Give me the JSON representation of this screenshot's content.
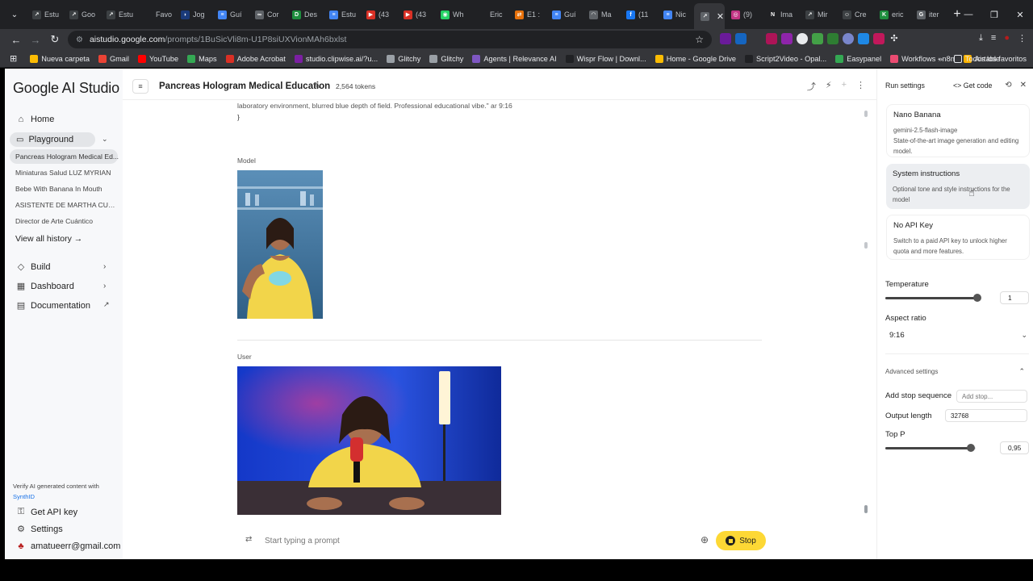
{
  "browser": {
    "tabs": [
      {
        "label": "Estu",
        "color": "#3c4043",
        "glyph": "↗"
      },
      {
        "label": "Goo",
        "color": "#3c4043",
        "glyph": "↗"
      },
      {
        "label": "Estu",
        "color": "#3c4043",
        "glyph": "↗"
      },
      {
        "label": "Favo",
        "color": "#202124",
        "glyph": ""
      },
      {
        "label": "Jog",
        "color": "#1a3a7a",
        "glyph": "◗"
      },
      {
        "label": "Guí",
        "color": "#4285f4",
        "glyph": "≡"
      },
      {
        "label": "Cor",
        "color": "#5f6368",
        "glyph": "∞"
      },
      {
        "label": "Des",
        "color": "#1e8e3e",
        "glyph": "D"
      },
      {
        "label": "Estu",
        "color": "#4285f4",
        "glyph": "≡"
      },
      {
        "label": "(43",
        "color": "#d93025",
        "glyph": "▶"
      },
      {
        "label": "(43",
        "color": "#d93025",
        "glyph": "▶"
      },
      {
        "label": "Wh",
        "color": "#25d366",
        "glyph": "◉"
      },
      {
        "label": "Eric",
        "color": "#202124",
        "glyph": ""
      },
      {
        "label": "E1 :",
        "color": "#e8710a",
        "glyph": "⇄"
      },
      {
        "label": "Guí",
        "color": "#4285f4",
        "glyph": "≡"
      },
      {
        "label": "Ma",
        "color": "#5f6368",
        "glyph": "◠"
      },
      {
        "label": "(11",
        "color": "#1877f2",
        "glyph": "f"
      },
      {
        "label": "Nic",
        "color": "#4285f4",
        "glyph": "≡"
      },
      {
        "label": "",
        "color": "#5f6368",
        "glyph": "↗",
        "active": true
      },
      {
        "label": "(9)",
        "color": "#c13584",
        "glyph": "◎"
      },
      {
        "label": "Ima",
        "color": "#202124",
        "glyph": "N"
      },
      {
        "label": "Mir",
        "color": "#3c4043",
        "glyph": "↗"
      },
      {
        "label": "Cre",
        "color": "#3c4043",
        "glyph": "☺"
      },
      {
        "label": "eric",
        "color": "#1e8e3e",
        "glyph": "K"
      },
      {
        "label": "iter",
        "color": "#5f6368",
        "glyph": "G"
      }
    ],
    "url_host": "aistudio.google.com",
    "url_path": "/prompts/1BuSicVli8m-U1P8siUXVionMAh6bxlst",
    "bookmarks": [
      {
        "label": "Nueva carpeta",
        "color": "#fbbc04"
      },
      {
        "label": "Gmail",
        "color": "#ea4335"
      },
      {
        "label": "YouTube",
        "color": "#ff0000"
      },
      {
        "label": "Maps",
        "color": "#34a853"
      },
      {
        "label": "Adobe Acrobat",
        "color": "#d93025"
      },
      {
        "label": "studio.clipwise.ai/?u...",
        "color": "#7b1fa2"
      },
      {
        "label": "Glitchy",
        "color": "#9aa0a6"
      },
      {
        "label": "Glitchy",
        "color": "#9aa0a6"
      },
      {
        "label": "Agents | Relevance AI",
        "color": "#7e57c2"
      },
      {
        "label": "Wispr Flow | Downl...",
        "color": "#202124"
      },
      {
        "label": "Home - Google Drive",
        "color": "#fbbc04"
      },
      {
        "label": "Script2Video - Opal...",
        "color": "#202124"
      },
      {
        "label": "Easypanel",
        "color": "#34a853"
      },
      {
        "label": "Workflows - n8n",
        "color": "#ea4b71"
      },
      {
        "label": "Airtable",
        "color": "#fcb400"
      }
    ],
    "bookmarks_overflow": "»",
    "all_bookmarks": "Todos los favoritos"
  },
  "sidebar": {
    "logo": "Google AI Studio",
    "home": "Home",
    "playground": "Playground",
    "history": [
      "Pancreas Hologram Medical Ed...",
      "Miniaturas Salud LUZ MYRIAN",
      "Bebe With Banana In Mouth",
      "ASISTENTE DE MARTHA CUAN...",
      "Director de Arte Cuántico"
    ],
    "view_all": "View all history →",
    "build": "Build",
    "dashboard": "Dashboard",
    "documentation": "Documentation",
    "verify_text": "Verify AI generated content with",
    "verify_link": "SynthID",
    "get_api_key": "Get API key",
    "settings": "Settings",
    "account": "amatueerr@gmail.com"
  },
  "header": {
    "title": "Pancreas Hologram Medical Education",
    "tokens": "2,564 tokens"
  },
  "chat": {
    "code_line_1": "laboratory environment, blurred blue depth of field. Professional educational vibe.\"   ar 9:16",
    "code_line_2": "}",
    "model_label": "Model",
    "user_label": "User",
    "prompt_placeholder": "Start typing a prompt",
    "stop_label": "Stop"
  },
  "run_settings": {
    "title": "Run settings",
    "get_code": "Get code",
    "model_name": "Nano Banana",
    "model_id": "gemini-2.5-flash-image",
    "model_desc": "State-of-the-art image generation and editing model.",
    "sys_title": "System instructions",
    "sys_desc": "Optional tone and style instructions for the model",
    "api_title": "No API Key",
    "api_desc": "Switch to a paid API key to unlock higher quota and more features.",
    "temperature_label": "Temperature",
    "temperature_value": "1",
    "temperature_fraction": 0.5,
    "aspect_label": "Aspect ratio",
    "aspect_value": "9:16",
    "advanced_label": "Advanced settings",
    "stop_seq_label": "Add stop sequence",
    "stop_seq_placeholder": "Add stop...",
    "output_length_label": "Output length",
    "output_length_value": "32768",
    "top_p_label": "Top P",
    "top_p_value": "0,95",
    "top_p_fraction": 0.95
  }
}
